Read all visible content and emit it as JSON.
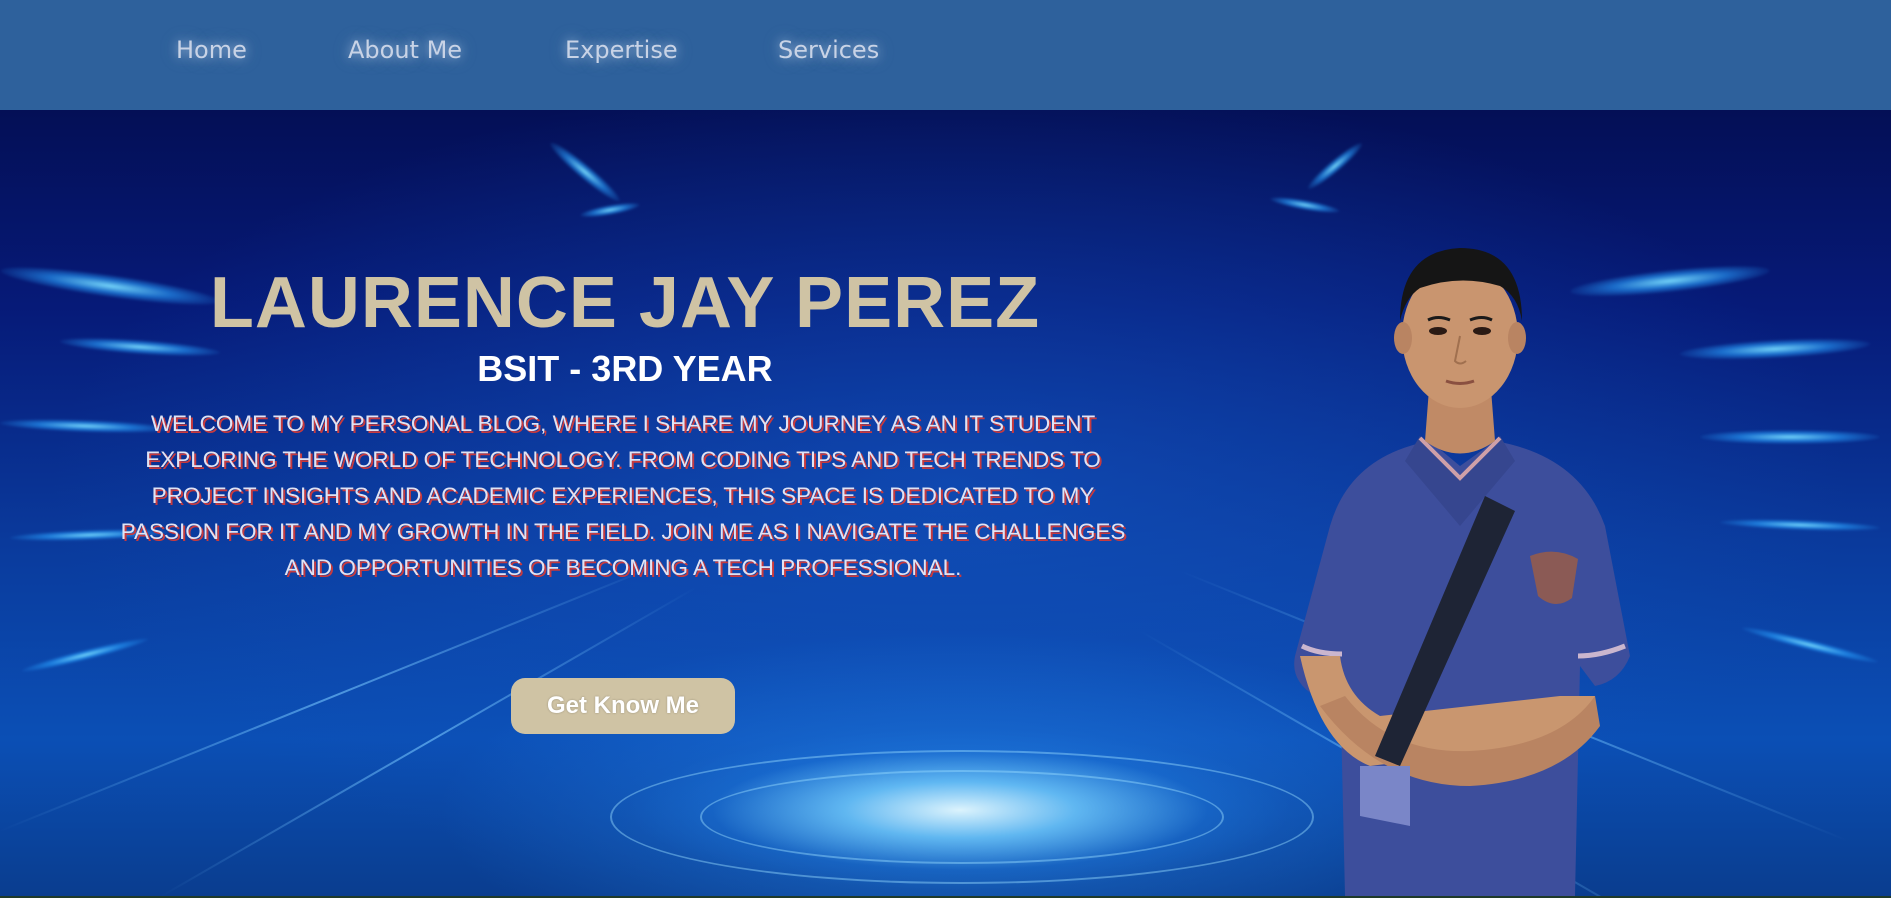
{
  "nav": {
    "items": [
      {
        "label": "Home"
      },
      {
        "label": "About Me"
      },
      {
        "label": "Expertise"
      },
      {
        "label": "Services"
      }
    ]
  },
  "hero": {
    "name": "LAURENCE JAY PEREZ",
    "subtitle": "BSIT - 3RD YEAR",
    "intro": "WELCOME TO MY PERSONAL BLOG, WHERE I SHARE MY JOURNEY AS AN IT STUDENT EXPLORING THE WORLD OF TECHNOLOGY. FROM CODING TIPS AND TECH TRENDS TO PROJECT INSIGHTS AND ACADEMIC EXPERIENCES, THIS SPACE IS DEDICATED TO MY PASSION FOR IT AND MY GROWTH IN THE FIELD. JOIN ME AS I NAVIGATE THE CHALLENGES AND OPPORTUNITIES OF BECOMING A TECH PROFESSIONAL.",
    "cta_label": "Get Know Me"
  },
  "colors": {
    "navbar": "#2e619c",
    "accent_beige": "#cfc3a4",
    "intro_shadow": "#c73a3e",
    "hero_dark": "#040f56"
  }
}
